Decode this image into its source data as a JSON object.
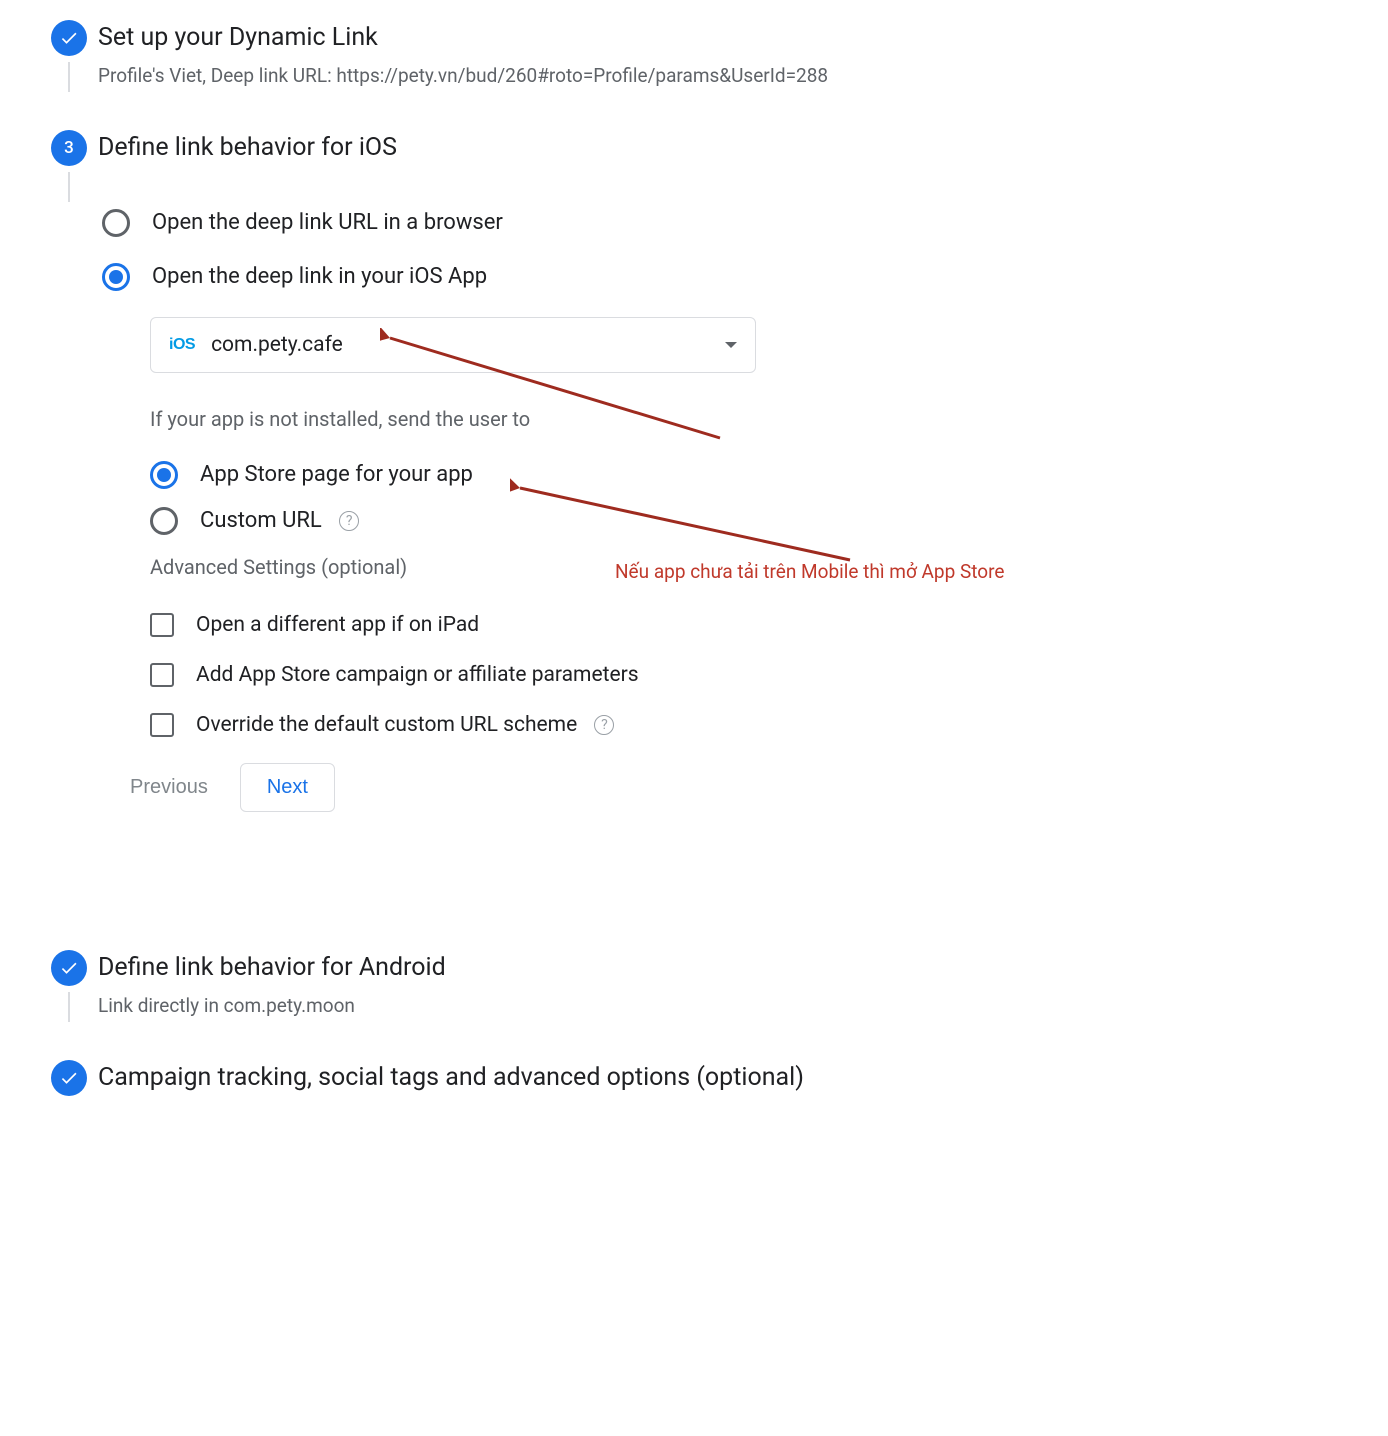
{
  "steps": {
    "setup": {
      "title": "Set up your Dynamic Link",
      "subtitle": "Profile's Viet, Deep link URL: https://pety.vn/bud/260#roto=Profile/params&UserId=288"
    },
    "ios": {
      "number": "3",
      "title": "Define link behavior for iOS"
    },
    "android": {
      "title": "Define link behavior for Android",
      "subtitle": "Link directly in com.pety.moon"
    },
    "campaign": {
      "title": "Campaign tracking, social tags and advanced options (optional)"
    }
  },
  "ios": {
    "radio_browser": "Open the deep link URL in a browser",
    "radio_app": "Open the deep link in your iOS App",
    "app_selector": {
      "ios_label": "iOS",
      "value": "com.pety.cafe"
    },
    "hint_not_installed": "If your app is not installed, send the user to",
    "radio_appstore": "App Store page for your app",
    "radio_custom": "Custom URL",
    "advanced_label": "Advanced Settings (optional)",
    "check_ipad": "Open a different app if on iPad",
    "check_campaign": "Add App Store campaign or affiliate parameters",
    "check_override": "Override the default custom URL scheme"
  },
  "buttons": {
    "previous": "Previous",
    "next": "Next"
  },
  "annotations": {
    "note1": "Nếu app chưa tải trên Mobile thì mở App Store"
  }
}
